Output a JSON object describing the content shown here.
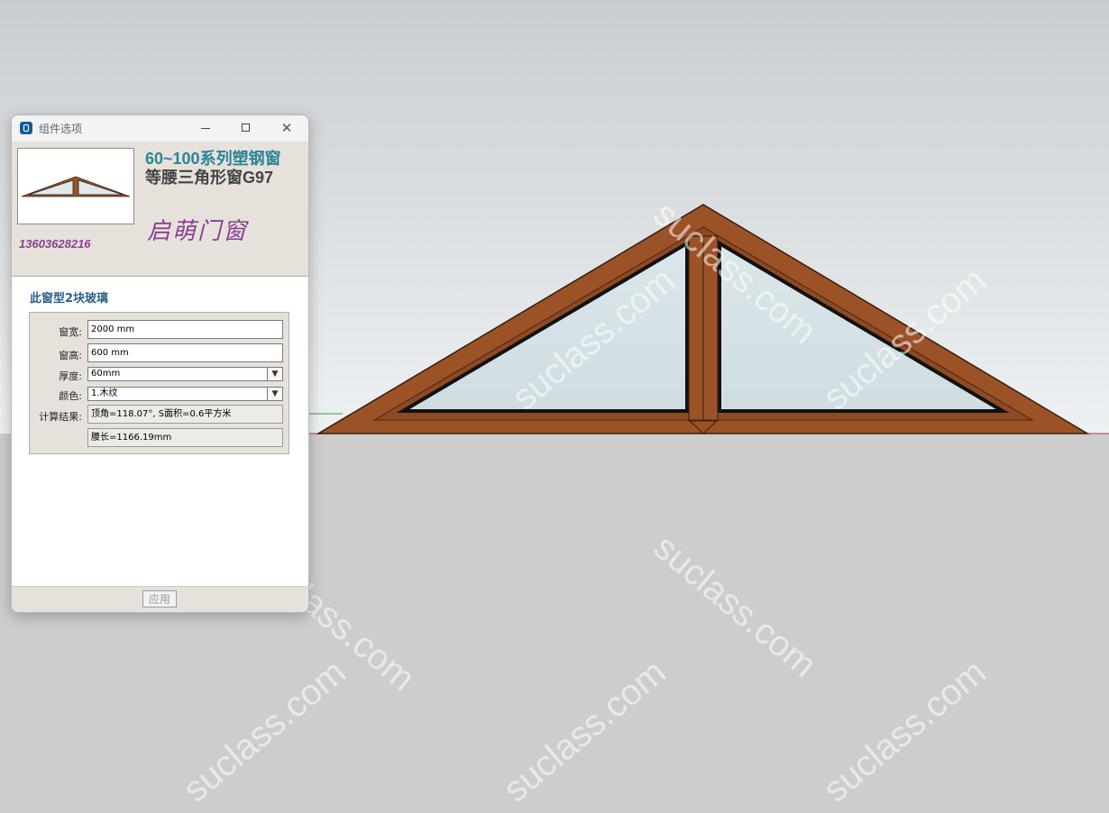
{
  "window": {
    "title": "组件选项"
  },
  "header": {
    "product_series": "60~100系列塑钢窗",
    "product_name": "等腰三角形窗G97",
    "brand": "启萌门窗",
    "phone": "13603628216"
  },
  "form": {
    "glass_note": "此窗型2块玻璃",
    "width": {
      "label": "窗宽:",
      "value": "2000 mm"
    },
    "height": {
      "label": "窗高:",
      "value": "600 mm"
    },
    "thickness": {
      "label": "厚度:",
      "value": "60mm"
    },
    "color": {
      "label": "颜色:",
      "value": "1.木纹"
    },
    "result": {
      "label": "计算结果:",
      "line1": "顶角=118.07°, S面积=0.6平方米",
      "line2": "腰长=1166.19mm"
    }
  },
  "footer": {
    "apply_label": "应用"
  },
  "watermark": "suclass.com",
  "colors": {
    "frame_wood": "#9a4e22",
    "sky": "#dde2e6",
    "ground": "#cfcfcf",
    "title_teal": "#2b8597",
    "brand_purple": "#8a3f8f"
  }
}
